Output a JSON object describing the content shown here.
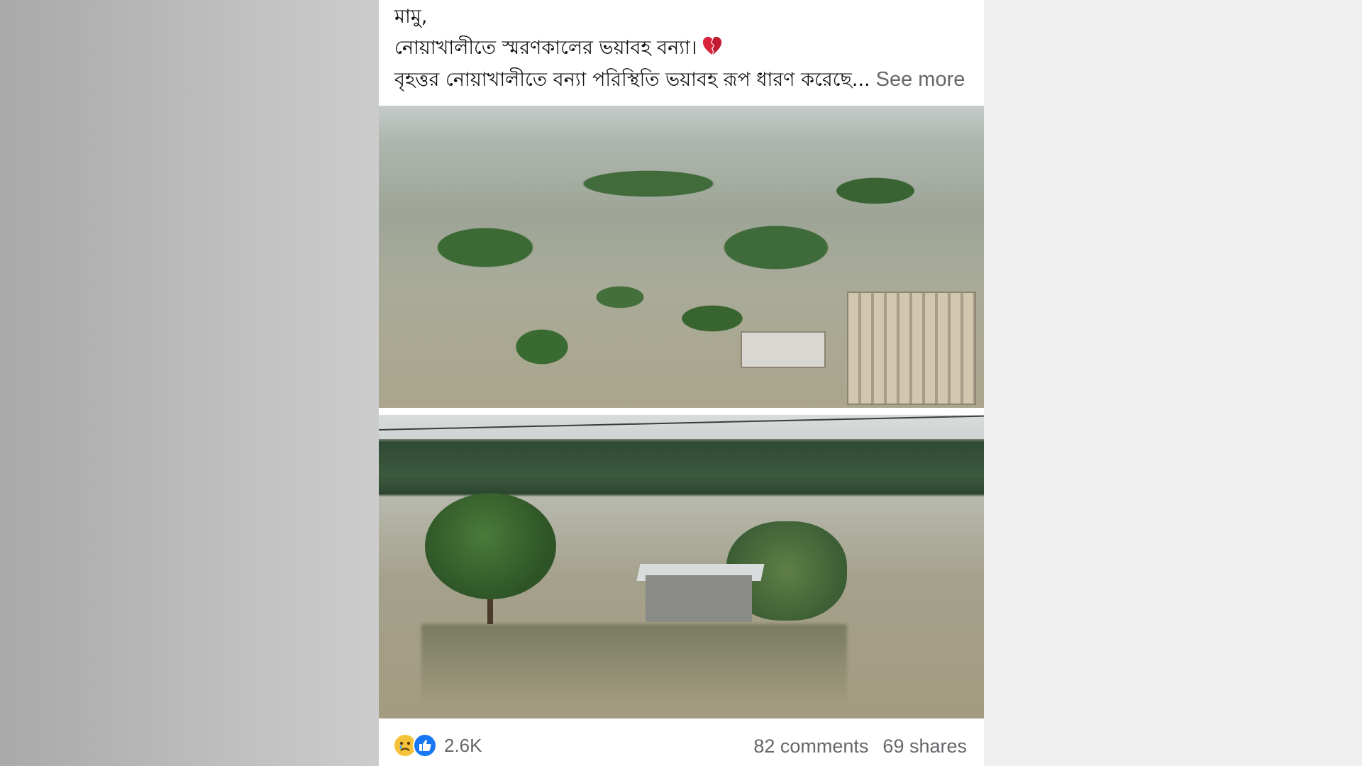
{
  "post": {
    "lines": [
      "মামু,",
      "নোয়াখালীতে স্মরণকালের ভয়াবহ বন্যা।",
      "বৃহত্তর নোয়াখালীতে বন্যা পরিস্থিতি ভয়াবহ রূপ ধারণ করেছে..."
    ],
    "see_more": "See more",
    "heart_icon": "broken-heart-emoji",
    "images": [
      "flood-aerial-photo",
      "flood-house-photo"
    ]
  },
  "footer": {
    "reaction_icons": [
      "sad-face",
      "thumbs-up"
    ],
    "reaction_count": "2.6K",
    "comments": "82 comments",
    "shares": "69 shares"
  },
  "colors": {
    "like_blue": "#1877f2",
    "sad_yellow": "#f5c33b",
    "secondary_text": "#65676b"
  }
}
